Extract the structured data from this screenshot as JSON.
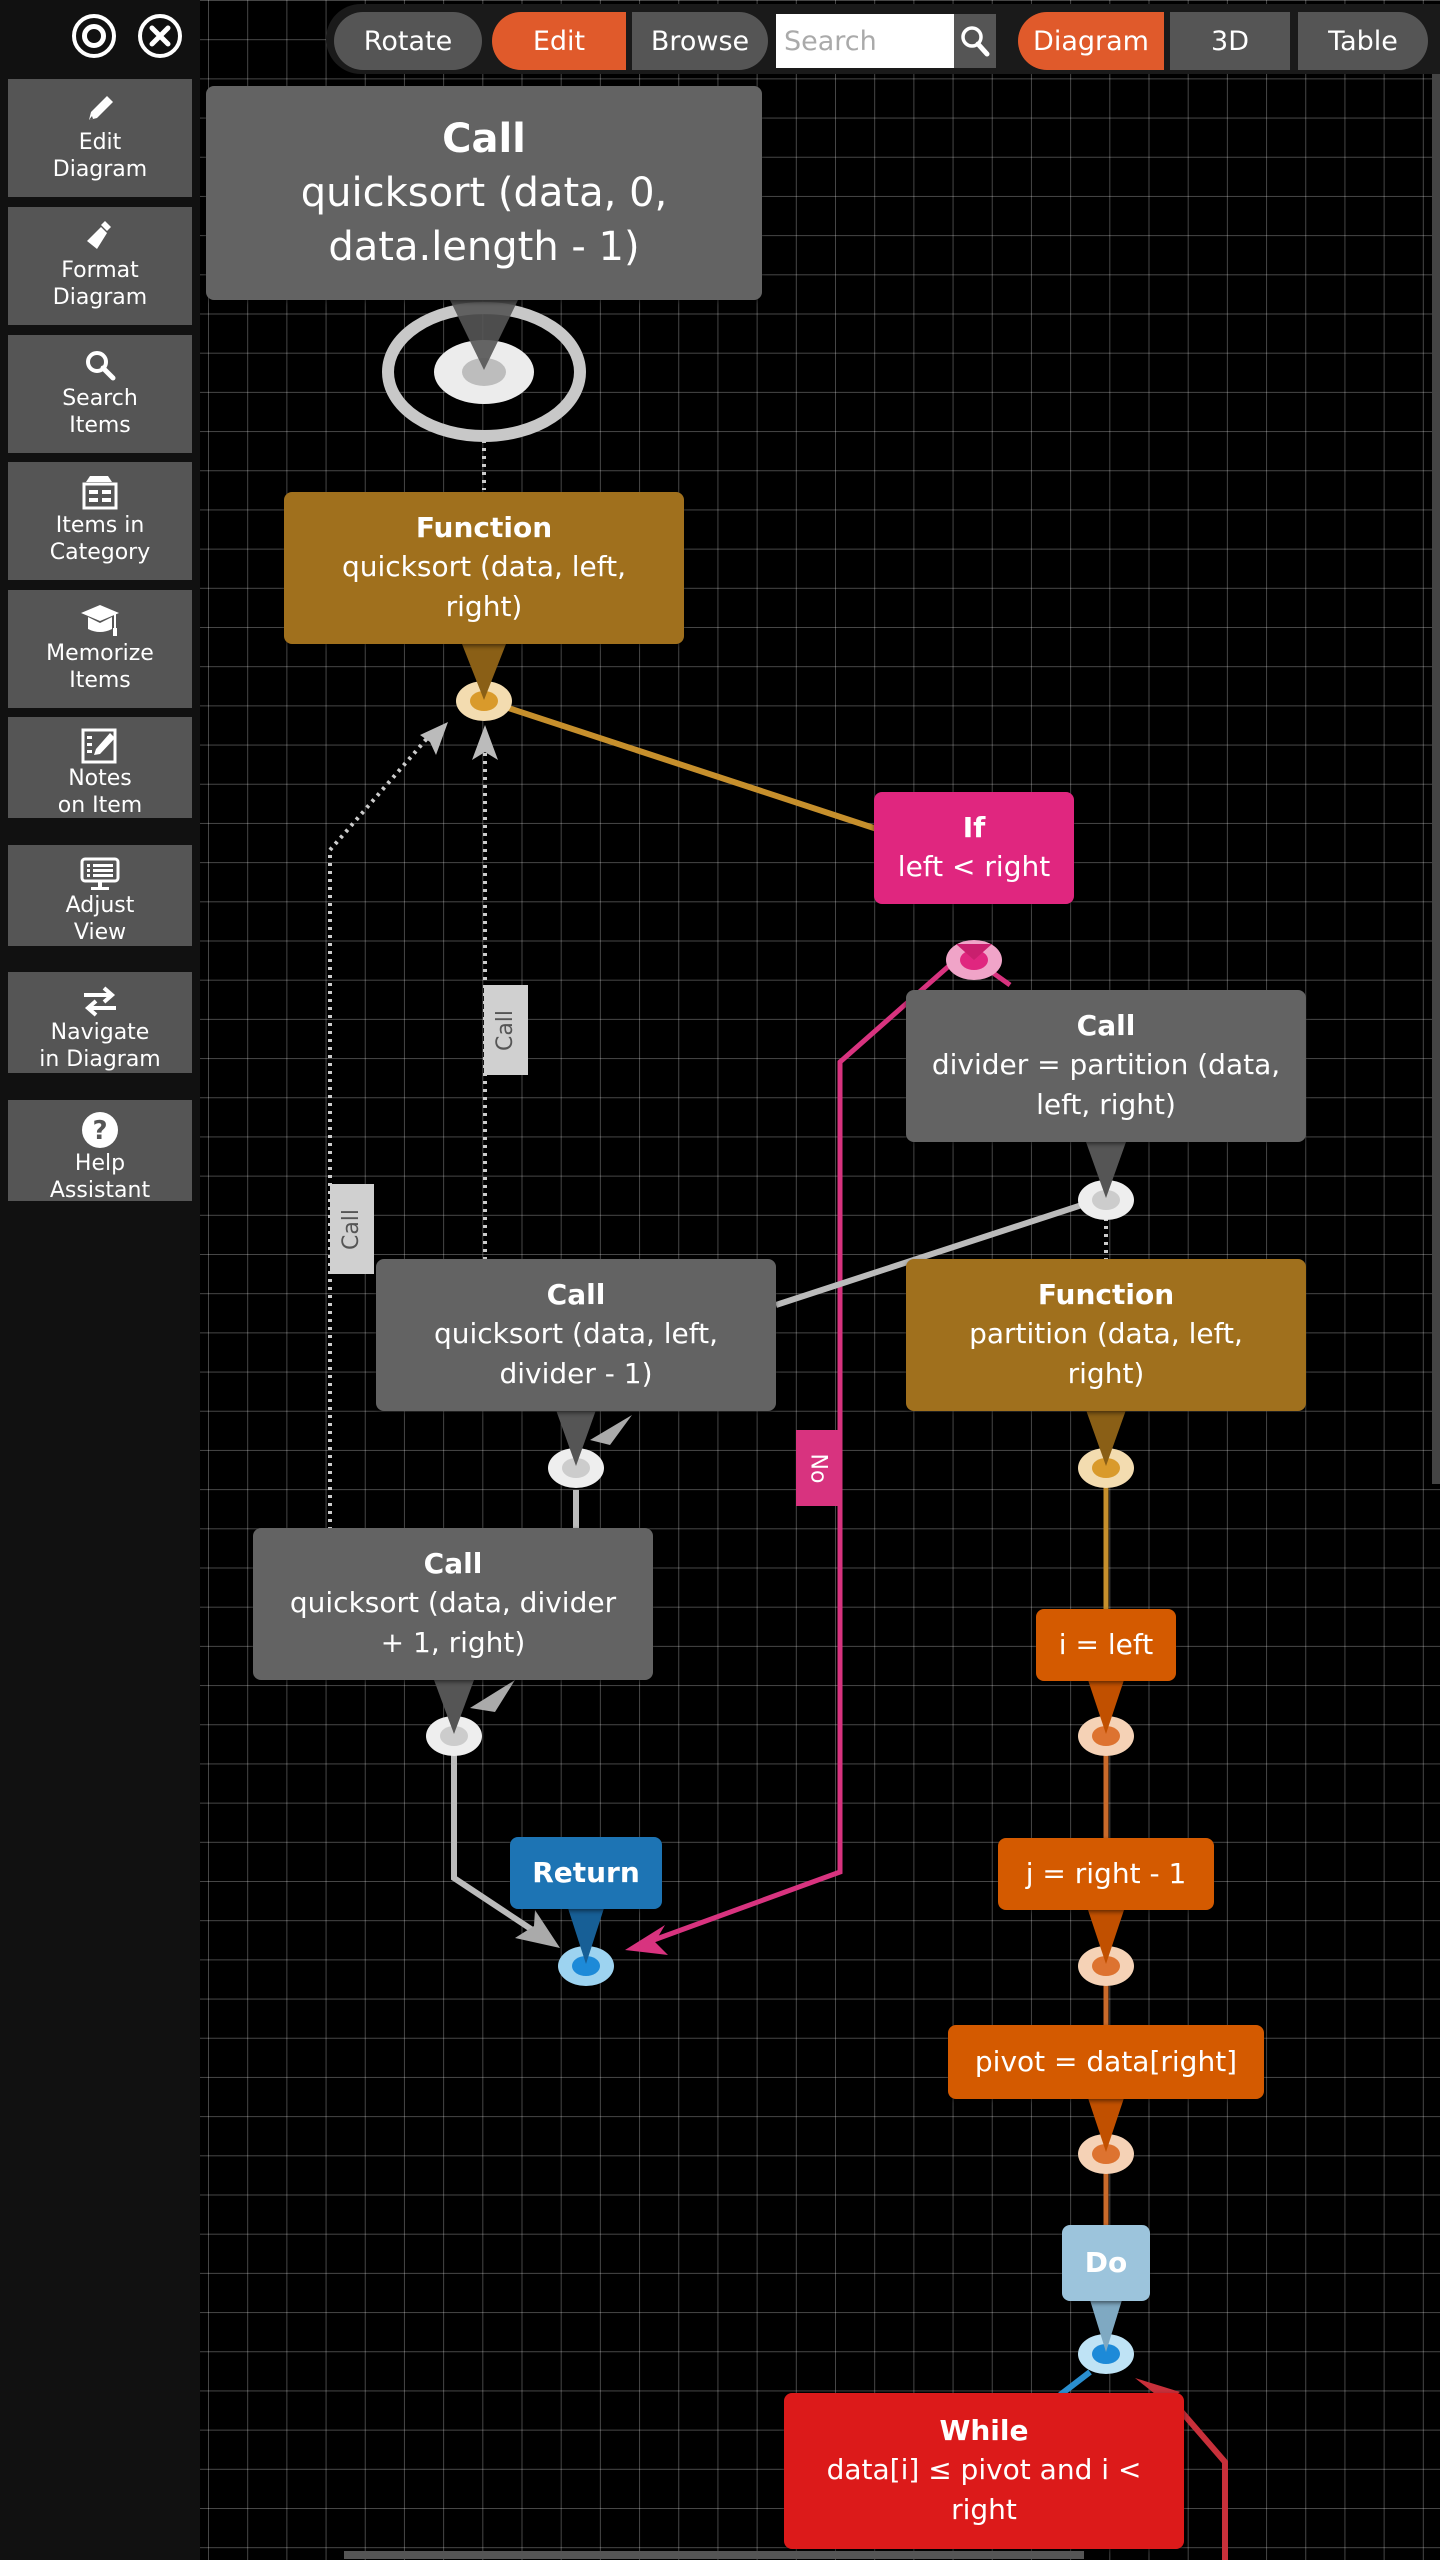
{
  "window_controls": {
    "settings_icon": "target-circle-icon",
    "close_icon": "close-x-icon"
  },
  "toolbar": {
    "rotate_label": "Rotate",
    "edit_label": "Edit",
    "browse_label": "Browse",
    "search_placeholder": "Search",
    "search_value": "",
    "diagram_label": "Diagram",
    "view_3d_label": "3D",
    "table_label": "Table",
    "active_mode": "Edit",
    "active_view": "Diagram",
    "accent_color": "#e05a2b"
  },
  "sidebar": {
    "items": [
      {
        "icon": "pencil-icon",
        "label_line1": "Edit",
        "label_line2": "Diagram"
      },
      {
        "icon": "paintbrush-icon",
        "label_line1": "Format",
        "label_line2": "Diagram"
      },
      {
        "icon": "magnifier-icon",
        "label_line1": "Search",
        "label_line2": "Items"
      },
      {
        "icon": "category-card-icon",
        "label_line1": "Items in",
        "label_line2": "Category"
      },
      {
        "icon": "graduation-cap-icon",
        "label_line1": "Memorize",
        "label_line2": "Items"
      },
      {
        "icon": "notes-pencil-icon",
        "label_line1": "Notes",
        "label_line2": "on Item"
      },
      {
        "icon": "monitor-list-icon",
        "label_line1": "Adjust",
        "label_line2": "View"
      },
      {
        "icon": "swap-arrows-icon",
        "label_line1": "Navigate",
        "label_line2": "in Diagram"
      },
      {
        "icon": "question-circle-icon",
        "label_line1": "Help",
        "label_line2": "Assistant"
      }
    ]
  },
  "diagram": {
    "nodes": {
      "call_root": {
        "type": "Call",
        "keyword": "Call",
        "line1": "quicksort (data, 0,",
        "line2": "data.length - 1)"
      },
      "func_quicksort": {
        "type": "Function",
        "keyword": "Function",
        "line1": "quicksort (data, left,",
        "line2": "right)"
      },
      "if_node": {
        "type": "If",
        "keyword": "If",
        "line1": "left < right"
      },
      "call_partition": {
        "type": "Call",
        "keyword": "Call",
        "line1": "divider = partition (data,",
        "line2": "left, right)"
      },
      "call_left": {
        "type": "Call",
        "keyword": "Call",
        "line1": "quicksort (data, left,",
        "line2": "divider - 1)"
      },
      "func_partition": {
        "type": "Function",
        "keyword": "Function",
        "line1": "partition (data, left,",
        "line2": "right)"
      },
      "call_right": {
        "type": "Call",
        "keyword": "Call",
        "line1": "quicksort (data, divider",
        "line2": "+ 1, right)"
      },
      "assign_i": {
        "type": "Assignment",
        "line1": "i = left"
      },
      "return_node": {
        "type": "Return",
        "keyword": "Return"
      },
      "assign_j": {
        "type": "Assignment",
        "line1": "j = right - 1"
      },
      "assign_pivot": {
        "type": "Assignment",
        "line1": "pivot = data[right]"
      },
      "do_node": {
        "type": "Do",
        "keyword": "Do"
      },
      "while_node": {
        "type": "While",
        "keyword": "While",
        "line1": "data[i] ≤ pivot and i <",
        "line2": "right"
      }
    },
    "edge_labels": {
      "call_label_1": "Call",
      "call_label_2": "Call",
      "no_label": "No"
    },
    "colors": {
      "call": "#636363",
      "function": "#a0701d",
      "if": "#e0267f",
      "assignment": "#d45a00",
      "return": "#1d74b4",
      "do": "#9cc4dc",
      "while": "#dc1a1a"
    }
  }
}
